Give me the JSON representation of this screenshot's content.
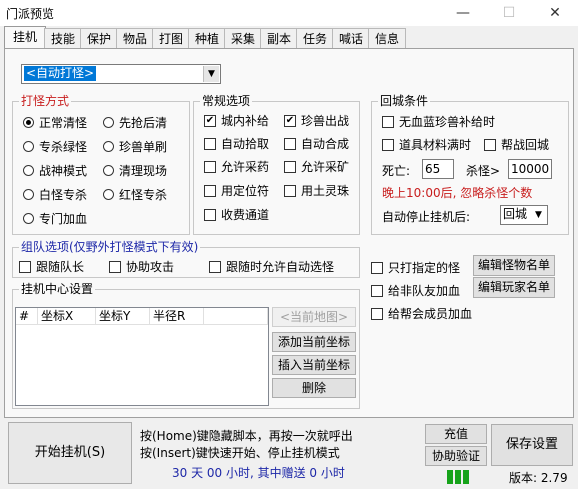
{
  "window": {
    "title": "门派预览",
    "minimize": "—",
    "maximize": "☐",
    "close": "✕"
  },
  "tabs": [
    "挂机",
    "技能",
    "保护",
    "物品",
    "打图",
    "种植",
    "采集",
    "副本",
    "任务",
    "喊话",
    "信息"
  ],
  "mode_select": {
    "value": "<自动打怪>"
  },
  "attack_mode": {
    "title": "打怪方式",
    "options": [
      {
        "label": "正常清怪",
        "selected": true
      },
      {
        "label": "先抢后清",
        "selected": false
      },
      {
        "label": "专杀绿怪",
        "selected": false
      },
      {
        "label": "珍兽单刷",
        "selected": false
      },
      {
        "label": "战神模式",
        "selected": false
      },
      {
        "label": "清理现场",
        "selected": false
      },
      {
        "label": "白怪专杀",
        "selected": false
      },
      {
        "label": "红怪专杀",
        "selected": false
      },
      {
        "label": "专门加血",
        "selected": false
      }
    ]
  },
  "general": {
    "title": "常规选项",
    "options": [
      {
        "label": "城内补给",
        "checked": true
      },
      {
        "label": "珍兽出战",
        "checked": true
      },
      {
        "label": "自动拾取",
        "checked": false
      },
      {
        "label": "自动合成",
        "checked": false
      },
      {
        "label": "允许采药",
        "checked": false
      },
      {
        "label": "允许采矿",
        "checked": false
      },
      {
        "label": "用定位符",
        "checked": false
      },
      {
        "label": "用土灵珠",
        "checked": false
      },
      {
        "label": "收费通道",
        "checked": false
      }
    ]
  },
  "return_city": {
    "title": "回城条件",
    "no_pet_food": "无血蓝珍兽补给时",
    "bag_full": "道具材料满时",
    "guild_return": "帮战回城",
    "death_label": "死亡:",
    "death_value": "65",
    "kill_label": "杀怪>",
    "kill_value": "10000",
    "night_note": "晚上10:00后, 忽略杀怪个数",
    "auto_stop_label": "自动停止挂机后:",
    "auto_stop_value": "回城"
  },
  "team": {
    "title": "组队选项(仅野外打怪模式下有效)",
    "follow_leader": "跟随队长",
    "assist_attack": "协助攻击",
    "follow_auto_select": "跟随时允许自动选怪"
  },
  "side_options": {
    "only_specified": "只打指定的怪",
    "edit_monsters": "编辑怪物名单",
    "heal_nonteam": "给非队友加血",
    "edit_players": "编辑玩家名单",
    "heal_guild": "给帮会成员加血"
  },
  "center": {
    "title": "挂机中心设置",
    "columns": [
      "#",
      "坐标X",
      "坐标Y",
      "半径R"
    ],
    "current_map": "<当前地图>",
    "add_coord": "添加当前坐标",
    "insert_coord": "插入当前坐标",
    "delete": "删除"
  },
  "bottom": {
    "start": "开始挂机(S)",
    "hint1": "按(Home)键隐藏脚本，再按一次就呼出",
    "hint2": "按(Insert)键快速开始、停止挂机模式",
    "time": "30 天 00 小时, 其中赠送 0 小时",
    "recharge": "充值",
    "verify": "协助验证",
    "save": "保存设置",
    "version": "版本: 2.79"
  }
}
